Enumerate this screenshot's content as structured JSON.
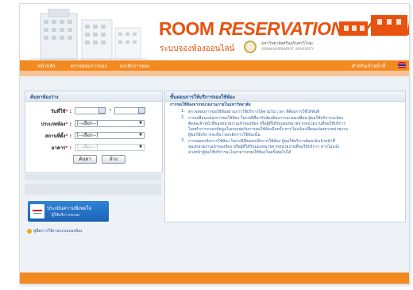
{
  "header": {
    "title_part1": "ROOM ",
    "title_part2": "RESERVATION SYSTEM",
    "subtitle": "ระบบจองห้องออนไลน์",
    "university": "มหาวิทยาลัยศรีนครินทรวิโรฒ",
    "university_en": "SRINAKHARINWIROT UNIVERSITY"
  },
  "nav": {
    "home": "หน้าหลัก",
    "check_booking": "ตรวจสอบการจอง",
    "cancel_booking": "ยกเลิกการจอง",
    "staff_login": "สำหรับเจ้าหน้าที่"
  },
  "search": {
    "title": "ค้นหาห้องว่าง",
    "date_label": "วันที่ใช้",
    "date_sep": "-",
    "room_type_label": "ประเภทห้อง",
    "location_label": "สถานที่ตั้ง",
    "building_label": "อาคาร",
    "select_placeholder": "[--เลือก--]",
    "search_button": "ค้นหา",
    "clear_button": "ล้าง"
  },
  "banner": {
    "line1": "ประเมินความพึงพอใจ",
    "line2": "ผู้ใช้บริการระบบ"
  },
  "manual_link": "คู่มือการใช้งานระบบจองห้อง",
  "info": {
    "title": "ขั้นตอนการให้บริการจองใช้ห้อง",
    "heading": "การขอใช้ห้องจากหน่วยงานภายในมหาวิทยาลัย",
    "items": [
      {
        "num": "1.",
        "lines": [
          "ตรวจสอบการขอใช้ห้องผ่านการใช้บริการได้ตามวัน เวลา ที่ต้องการใช้ได้ทันที"
        ]
      },
      {
        "num": "2.",
        "lines": [
          "การเปลี่ยนแปลงการขอใช้ห้อง ในกรณีที่มารับห้องต้องการจะขอเปลี่ยน ผู้ขอใช้บริการจะต้อง",
          "ติดต่อเจ้าหน้าที่ของหน่วยงานเจ้าของห้อง หรือผู้ที่ได้รับมอบหมายจากหน่วยงานที่ขอใช้บริการ",
          "โดยทำการกรอกข้อมูลในแบบฟอร์มการขอใช้ห้องอีกครั้ง หากไม่แจ้งเปลี่ยนแปลงทางหน่วยงาน",
          "ผู้ขอใช้บริการจะถือว่ายกเลิกการใช้ห้องนั้น"
        ]
      },
      {
        "num": "3.",
        "lines": [
          "การขอยกเลิกการใช้ห้อง ในกรณีที่ขอยกเลิกการใช้ห้อง ผู้ขอใช้บริการต้องแจ้งเจ้าหน้าที่",
          "ของหน่วยงานเจ้าของห้อง หรือผู้ที่ได้รับมอบหมายจากหน่วยงานที่ขอใช้บริการ หากไม่แจ้ง",
          "ล่วงหน้าผู้ขอใช้บริการจะไม่สามารถขอใช้ห้องในครั้งต่อไปได้"
        ]
      }
    ]
  },
  "colors": {
    "brand_orange": "#e8510f",
    "nav_orange": "#f28a20",
    "link_blue": "#1c4f8a"
  }
}
